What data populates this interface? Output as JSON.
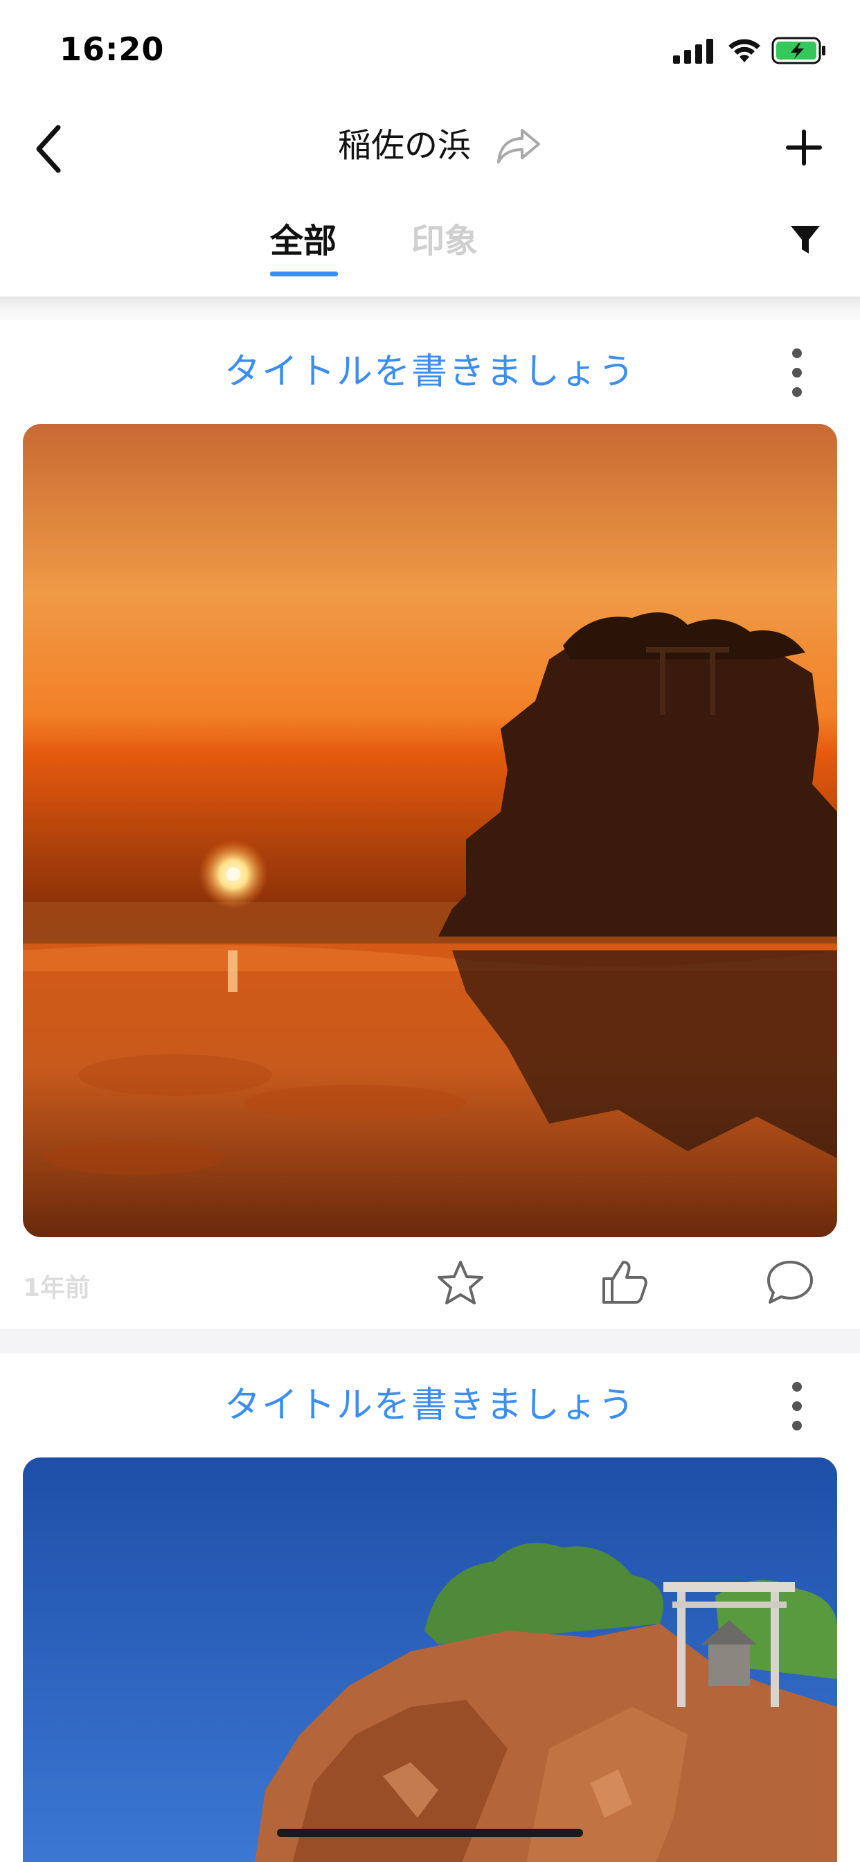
{
  "status_bar": {
    "time": "16:20"
  },
  "nav": {
    "title": "稲佐の浜"
  },
  "tabs": [
    {
      "label": "全部",
      "active": true
    },
    {
      "label": "印象",
      "active": false
    }
  ],
  "posts": [
    {
      "title": "タイトルを書きましょう",
      "image": "sunset-beach-rock-photo",
      "time_ago": "1年前"
    },
    {
      "title": "タイトルを書きましょう",
      "image": "blue-sky-rock-shrine-photo"
    }
  ],
  "icons": {
    "back": "chevron-left-icon",
    "share": "share-arrow-icon",
    "add": "plus-icon",
    "filter": "funnel-icon",
    "more": "vertical-dots-icon",
    "favorite": "star-icon",
    "like": "thumbs-up-icon",
    "comment": "speech-bubble-icon"
  },
  "colors": {
    "accent": "#3b8ef0",
    "inactive_tab": "#cfcfcf",
    "timestamp": "#dcdcdc",
    "background": "#f4f4f6"
  }
}
